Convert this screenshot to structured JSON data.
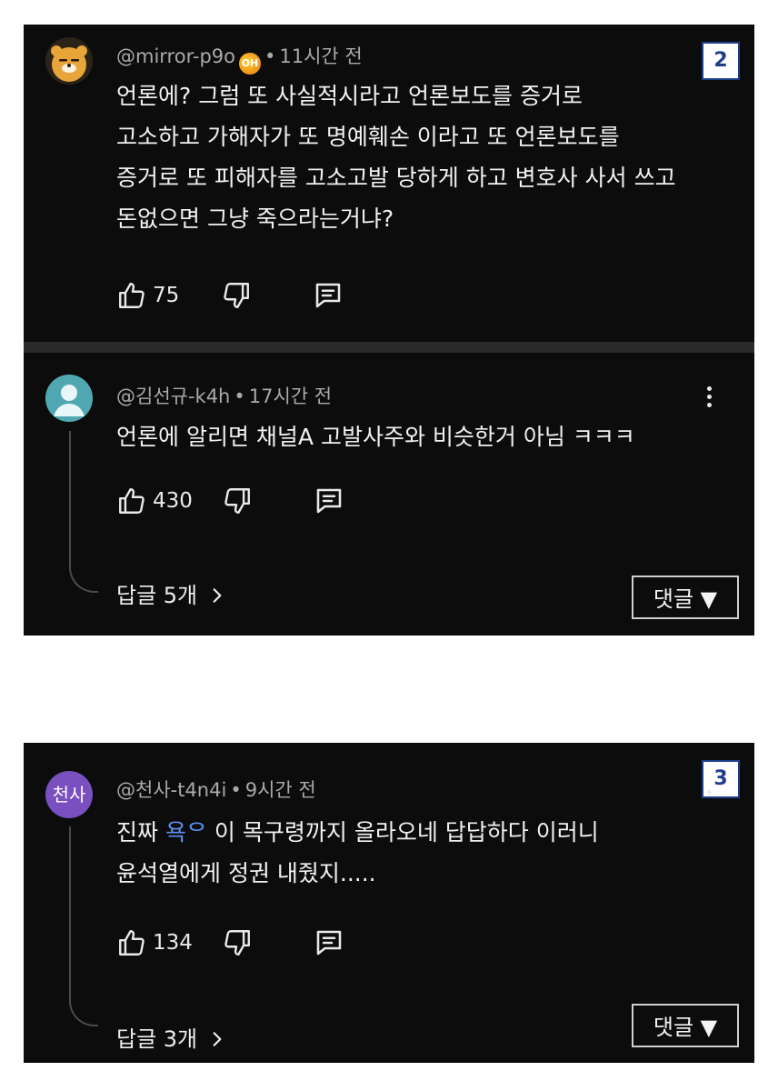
{
  "panel1": {
    "badge": "2",
    "comment": {
      "handle": "@mirror-p9o",
      "badge_icon": "OH",
      "time": "11시간 전",
      "lines": [
        "언론에?  그럼 또  사실적시라고 언론보도를 증거로",
        "고소하고 가해자가 또 명예훼손 이라고 또 언론보도를",
        "증거로 또 피해자를 고소고발 당하게 하고 변호사 사서 쓰고",
        "돈없으면 그냥 죽으라는거냐?"
      ],
      "likes": "75"
    },
    "reply": {
      "handle": "@김선규-k4h",
      "time": "17시간 전",
      "text": "언론에 알리면 채널A 고발사주와 비슷한거 아님 ㅋㅋㅋ",
      "likes": "430",
      "replies_label": "답글 5개",
      "reply_button": "댓글 ▼"
    }
  },
  "panel2": {
    "badge": "3",
    "comment": {
      "avatar_text": "천사",
      "handle": "@천사-t4n4i",
      "time": "9시간 전",
      "line1_prefix": "진짜 ",
      "line1_highlight": "욕ᄋ",
      "line1_rest": "이 목구령까지 올라오네 답답하다 이러니",
      "line2": "윤석열에게 정권 내줬지.....",
      "likes": "134",
      "replies_label": "답글 3개",
      "reply_button": "댓글 ▼"
    }
  },
  "icons": [
    "thumbs-up-icon",
    "thumbs-down-icon",
    "comment-icon",
    "more-vert-icon",
    "chevron-right-icon"
  ],
  "colors": {
    "background": "#0c0c0c",
    "text": "#f1f1f1",
    "meta": "#a9a9a9",
    "badge_border": "#1f3d8a",
    "avatar_purple": "#7a4fc0",
    "avatar_teal": "#4fa7b2"
  }
}
